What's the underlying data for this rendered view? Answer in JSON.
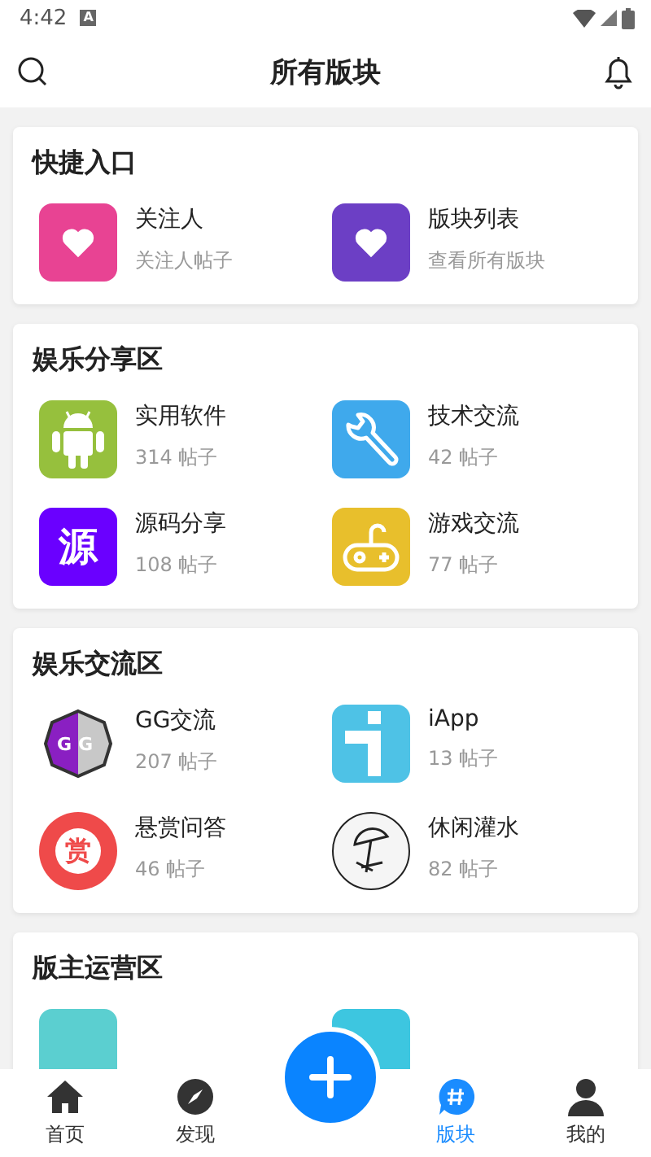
{
  "status_bar": {
    "time": "4:42",
    "notification_badge": "A"
  },
  "header": {
    "title": "所有版块"
  },
  "sections": [
    {
      "title": "快捷入口",
      "items": [
        {
          "kind": "forum",
          "name": "关注人",
          "subtitle": "关注人帖子"
        },
        {
          "kind": "forum",
          "name": "版块列表",
          "subtitle": "查看所有版块"
        }
      ]
    },
    {
      "title": "娱乐分享区",
      "items": [
        {
          "kind": "forum",
          "name": "实用软件",
          "subtitle": "314 帖子"
        },
        {
          "kind": "forum",
          "name": "技术交流",
          "subtitle": "42 帖子"
        },
        {
          "kind": "forum",
          "name": "源码分享",
          "subtitle": "108 帖子",
          "glyph": "源"
        },
        {
          "kind": "forum",
          "name": "游戏交流",
          "subtitle": "77 帖子"
        }
      ]
    },
    {
      "title": "娱乐交流区",
      "items": [
        {
          "kind": "forum",
          "name": "GG交流",
          "subtitle": "207 帖子",
          "glyph": "GG"
        },
        {
          "kind": "forum",
          "name": "iApp",
          "subtitle": "13 帖子"
        },
        {
          "kind": "forum",
          "name": "悬赏问答",
          "subtitle": "46 帖子",
          "glyph": "赏"
        },
        {
          "kind": "forum",
          "name": "休闲灌水",
          "subtitle": "82 帖子"
        }
      ]
    },
    {
      "title": "版主运营区",
      "items": [
        {
          "kind": "partial"
        },
        {
          "kind": "partial"
        }
      ]
    }
  ],
  "nav": [
    {
      "label": "首页",
      "selected": false
    },
    {
      "label": "发现",
      "selected": false
    },
    {
      "label": "版块",
      "selected": true
    },
    {
      "label": "我的",
      "selected": false
    }
  ]
}
